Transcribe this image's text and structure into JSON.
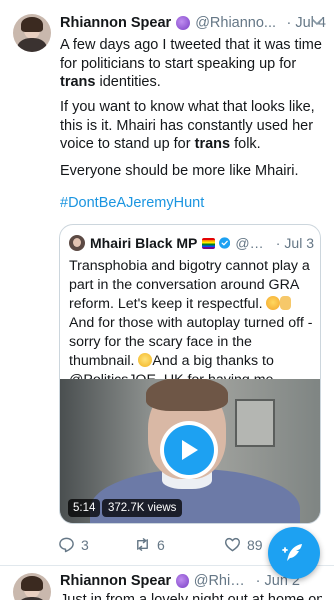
{
  "tweet": {
    "author_name": "Rhiannon Spear",
    "author_handle": "@Rhianno...",
    "separator": "·",
    "date": "Jul 4",
    "para1_a": "A few days ago I tweeted that it was time for politicians to start speaking up for ",
    "para1_bold": "trans",
    "para1_b": " identities.",
    "para2_a": "If you want to know what that looks like, this is it. Mhairi has constantly used her voice to stand up for ",
    "para2_bold": "trans",
    "para2_b": " folk.",
    "para3": "Everyone should be more like Mhairi.",
    "hashtag": "#DontBeAJeremyHunt"
  },
  "quoted_tweet": {
    "author_name": "Mhairi Black MP",
    "author_handle": "@Mh...",
    "separator": "·",
    "date": "Jul 3",
    "text_1": "Transphobia and bigotry cannot play a part in the conversation around GRA reform. Let's keep it respectful. ",
    "text_2": " And for those with autoplay turned off - sorry for the scary face in the thumbnail. ",
    "text_3": "And a big thanks to @PoliticsJOE_UK for having me.",
    "video": {
      "duration": "5:14",
      "views": "372.7K views"
    }
  },
  "actions": {
    "reply_count": "3",
    "retweet_count": "6",
    "like_count": "89"
  },
  "next_tweet": {
    "author_name": "Rhiannon Spear",
    "author_handle": "@Rhian...",
    "separator": "·",
    "date": "Jun 2",
    "text": "Just in from a lovely night out at home on"
  },
  "colors": {
    "accent": "#1da1f2",
    "link": "#1b95e0",
    "secondary_text": "#657786",
    "border": "#ccd6dd"
  },
  "icons": [
    "chevron-down-icon",
    "verified-icon",
    "play-icon",
    "reply-icon",
    "retweet-icon",
    "like-icon",
    "share-icon",
    "compose-tweet-icon"
  ]
}
